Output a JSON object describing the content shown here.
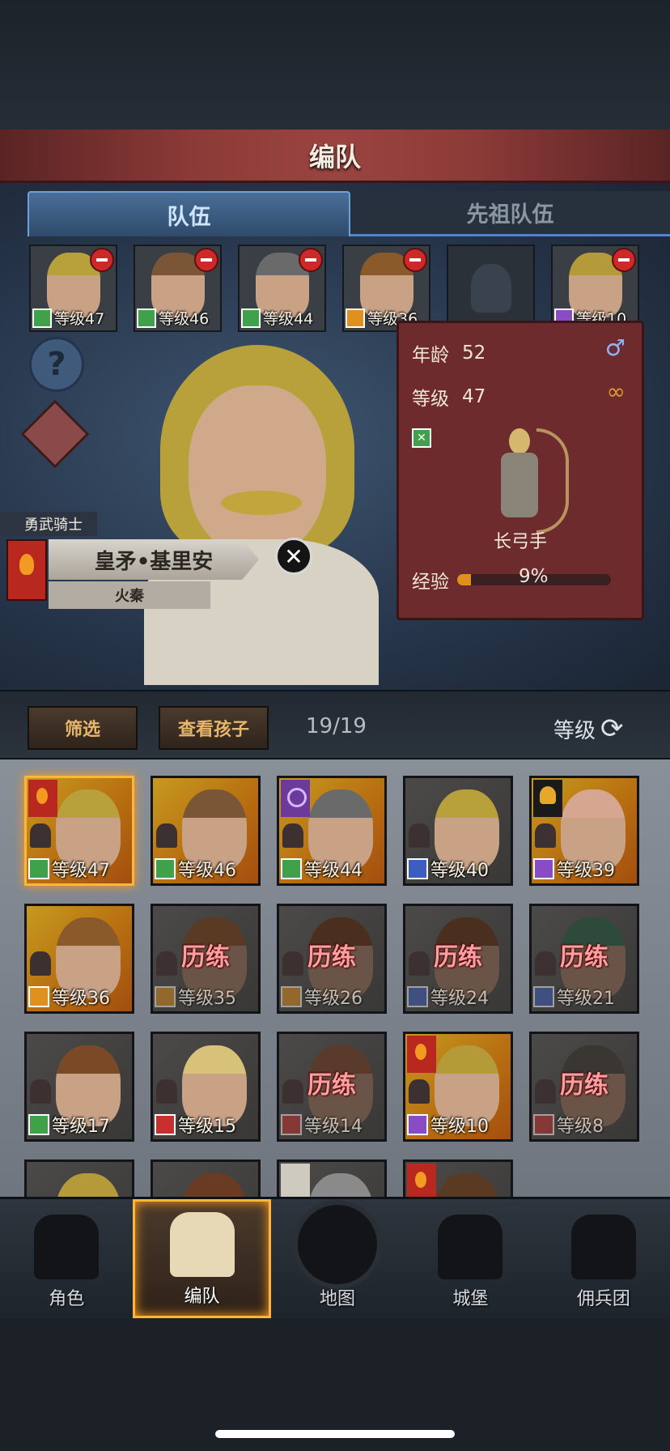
{
  "header": {
    "title": "编队"
  },
  "tabs": [
    {
      "label": "队伍",
      "active": true
    },
    {
      "label": "先祖队伍",
      "active": false
    }
  ],
  "team_slots": [
    {
      "level": "等级47",
      "class_icon": "bow-class-icon",
      "class_color": "green",
      "hair": "#b8a13a",
      "removable": true
    },
    {
      "level": "等级46",
      "class_icon": "bow-class-icon",
      "class_color": "green",
      "hair": "#7a5636",
      "removable": true
    },
    {
      "level": "等级44",
      "class_icon": "bow-class-icon",
      "class_color": "green",
      "hair": "#6a6a6a",
      "removable": true
    },
    {
      "level": "等级36",
      "class_icon": "shield-class-icon",
      "class_color": "orange",
      "hair": "#8a5a2a",
      "removable": true
    },
    {
      "empty": true
    },
    {
      "level": "等级10",
      "class_icon": "staff-class-icon",
      "class_color": "purple",
      "hair": "#b59a3a",
      "removable": true
    }
  ],
  "hero": {
    "title": "勇武骑士",
    "name": "皇矛•基里安",
    "house": "火秦"
  },
  "info": {
    "age_label": "年龄",
    "age": "52",
    "level_label": "等级",
    "level": "47",
    "gender_symbol": "♂",
    "ring_symbol": "∞",
    "unit_type": "长弓手",
    "exp_label": "经验",
    "exp_percent": "9%",
    "exp_fraction": 0.09
  },
  "toolbar": {
    "filter_label": "筛选",
    "children_label": "查看孩子",
    "count": "19/19",
    "sort_label": "等级"
  },
  "roster": [
    {
      "level": "等级47",
      "cls": "green",
      "tone": "gold",
      "emblem": "fire",
      "hair": "#b8a13a",
      "selected": true
    },
    {
      "level": "等级46",
      "cls": "green",
      "tone": "gold",
      "hair": "#7a5636"
    },
    {
      "level": "等级44",
      "cls": "green",
      "tone": "gold",
      "emblem": "purple",
      "hair": "#6a6a6a"
    },
    {
      "level": "等级40",
      "cls": "blue",
      "tone": "grey",
      "hair": "#b8a13a"
    },
    {
      "level": "等级39",
      "cls": "purple",
      "tone": "gold",
      "emblem": "tree",
      "hair": "#d6a690"
    },
    {
      "level": "等级36",
      "cls": "orange",
      "tone": "gold",
      "hair": "#8a5a2a"
    },
    {
      "level": "等级35",
      "cls": "orange",
      "tone": "grey",
      "train": "历练",
      "hair": "#5a3a22"
    },
    {
      "level": "等级26",
      "cls": "orange",
      "tone": "grey",
      "train": "历练",
      "hair": "#4a2e1e"
    },
    {
      "level": "等级24",
      "cls": "blue",
      "tone": "grey",
      "train": "历练",
      "hair": "#4a2e1e"
    },
    {
      "level": "等级21",
      "cls": "blue",
      "tone": "grey",
      "train": "历练",
      "hair": "#2e4a3a"
    },
    {
      "level": "等级17",
      "cls": "green",
      "tone": "grey",
      "hair": "#7a4a26"
    },
    {
      "level": "等级15",
      "cls": "red",
      "tone": "grey",
      "hair": "#d8c27a"
    },
    {
      "level": "等级14",
      "cls": "red",
      "tone": "grey",
      "train": "历练",
      "hair": "#5a3a2a"
    },
    {
      "level": "等级10",
      "cls": "purple",
      "tone": "gold",
      "emblem": "fire",
      "hair": "#b59a3a"
    },
    {
      "level": "等级8",
      "cls": "red",
      "tone": "grey",
      "train": "历练",
      "hair": "#3a3632"
    },
    {
      "level": "",
      "cls": "",
      "tone": "grey",
      "hair": "#b59a3a"
    },
    {
      "level": "",
      "cls": "",
      "tone": "grey",
      "hair": "#6a3a22"
    },
    {
      "level": "",
      "cls": "",
      "tone": "grey",
      "emblem": "plain",
      "hair": "#8a8a8a"
    },
    {
      "level": "",
      "cls": "",
      "tone": "grey",
      "emblem": "fire",
      "hair": "#5a3a22"
    }
  ],
  "nav": [
    {
      "label": "角色",
      "icon": "knight-icon",
      "active": false
    },
    {
      "label": "编队",
      "icon": "helmet-icon",
      "active": true
    },
    {
      "label": "地图",
      "icon": "compass-icon",
      "active": false
    },
    {
      "label": "城堡",
      "icon": "castle-icon",
      "active": false
    },
    {
      "label": "佣兵团",
      "icon": "mercenary-icon",
      "active": false
    }
  ]
}
